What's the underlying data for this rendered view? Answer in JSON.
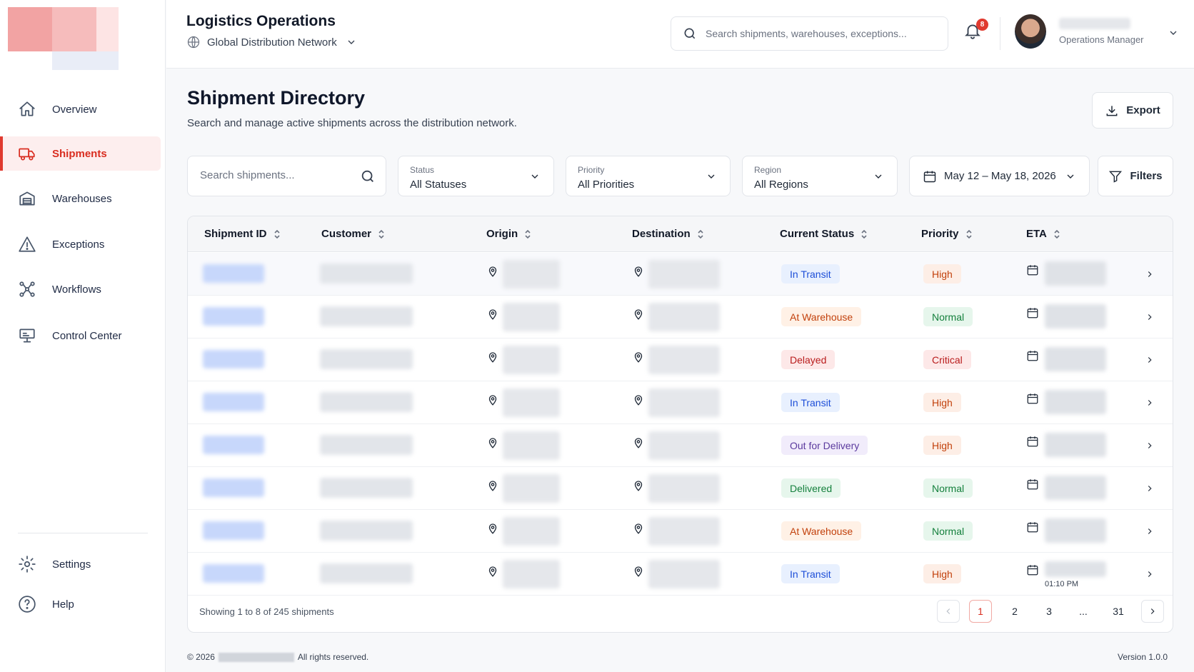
{
  "app": {
    "title": "Logistics Operations",
    "network": "Global Distribution Network"
  },
  "search": {
    "placeholder": "Search shipments, warehouses, exceptions..."
  },
  "notifications": {
    "count": "8"
  },
  "user": {
    "role": "Operations Manager"
  },
  "sidebar": {
    "items": [
      {
        "label": "Overview",
        "icon": "home-icon"
      },
      {
        "label": "Shipments",
        "icon": "truck-icon",
        "active": true
      },
      {
        "label": "Warehouses",
        "icon": "warehouse-icon"
      },
      {
        "label": "Exceptions",
        "icon": "alert-triangle-icon"
      },
      {
        "label": "Workflows",
        "icon": "workflow-icon"
      },
      {
        "label": "Control Center",
        "icon": "monitor-icon"
      }
    ],
    "bottom": [
      {
        "label": "Settings",
        "icon": "gear-icon"
      },
      {
        "label": "Help",
        "icon": "help-circle-icon"
      }
    ]
  },
  "page": {
    "title": "Shipment Directory",
    "subtitle": "Search and manage active shipments across the distribution network.",
    "export_label": "Export"
  },
  "filters": {
    "search_placeholder": "Search shipments...",
    "status": {
      "label": "Status",
      "value": "All Statuses"
    },
    "priority": {
      "label": "Priority",
      "value": "All Priorities"
    },
    "region": {
      "label": "Region",
      "value": "All Regions"
    },
    "date_range": "May 12 – May 18, 2026",
    "filters_label": "Filters"
  },
  "table": {
    "columns": [
      "Shipment ID",
      "Customer",
      "Origin",
      "Destination",
      "Current Status",
      "Priority",
      "ETA"
    ],
    "rows": [
      {
        "status": "In Transit",
        "priority": "High",
        "eta_time": ""
      },
      {
        "status": "At Warehouse",
        "priority": "Normal",
        "eta_time": ""
      },
      {
        "status": "Delayed",
        "priority": "Critical",
        "eta_time": ""
      },
      {
        "status": "In Transit",
        "priority": "High",
        "eta_time": ""
      },
      {
        "status": "Out for Delivery",
        "priority": "High",
        "eta_time": ""
      },
      {
        "status": "Delivered",
        "priority": "Normal",
        "eta_time": ""
      },
      {
        "status": "At Warehouse",
        "priority": "Normal",
        "eta_time": ""
      },
      {
        "status": "In Transit",
        "priority": "High",
        "eta_time": "01:10 PM"
      }
    ],
    "footer": "Showing 1 to 8 of 245 shipments",
    "pages": [
      "1",
      "2",
      "3",
      "...",
      "31"
    ]
  },
  "footer": {
    "copyright_prefix": "© 2026",
    "copyright_suffix": "All rights reserved.",
    "version": "Version 1.0.0"
  },
  "colors": {
    "accent": "#e03a2f"
  }
}
